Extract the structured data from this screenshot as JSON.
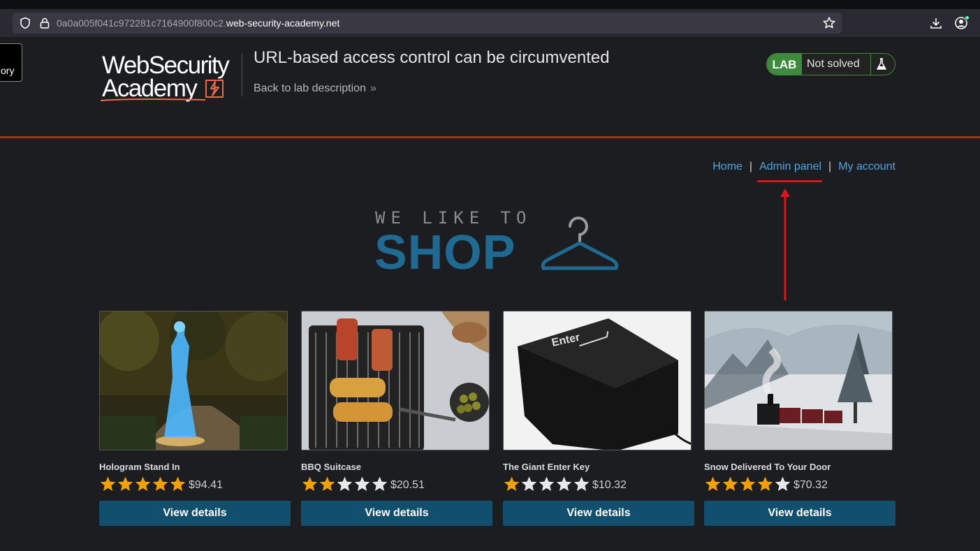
{
  "browser": {
    "url_prefix": "0a0a005f041c972281c7164900f800c2.",
    "url_domain": "web-security-academy.net",
    "side_tab_label": "ory"
  },
  "header": {
    "logo_line1": "WebSecurity",
    "logo_line2": "Academy",
    "lab_title": "URL-based access control can be circumvented",
    "back_link": "Back to lab description",
    "back_chevron": "»",
    "badge_label": "LAB",
    "badge_status": "Not solved"
  },
  "nav": {
    "home": "Home",
    "separator": "|",
    "admin": "Admin panel",
    "account": "My account"
  },
  "banner": {
    "tagline": "WE LIKE TO",
    "word": "SHOP"
  },
  "products": [
    {
      "name": "Hologram Stand In",
      "rating": 5,
      "price": "$94.41",
      "button": "View details"
    },
    {
      "name": "BBQ Suitcase",
      "rating": 2,
      "price": "$20.51",
      "button": "View details"
    },
    {
      "name": "The Giant Enter Key",
      "rating": 1,
      "price": "$10.32",
      "button": "View details"
    },
    {
      "name": "Snow Delivered To Your Door",
      "rating": 4,
      "price": "$70.32",
      "button": "View details"
    }
  ],
  "product_images": {
    "enter_key_text": "Enter"
  },
  "colors": {
    "accent_blue": "#124e6d",
    "link_blue": "#4fa6e0",
    "star_gold": "#f4a100",
    "star_empty": "#e8e8e8",
    "lab_green": "#3d8c3d",
    "annotation_red": "#e0141a",
    "rule_orange": "#a3300f"
  }
}
